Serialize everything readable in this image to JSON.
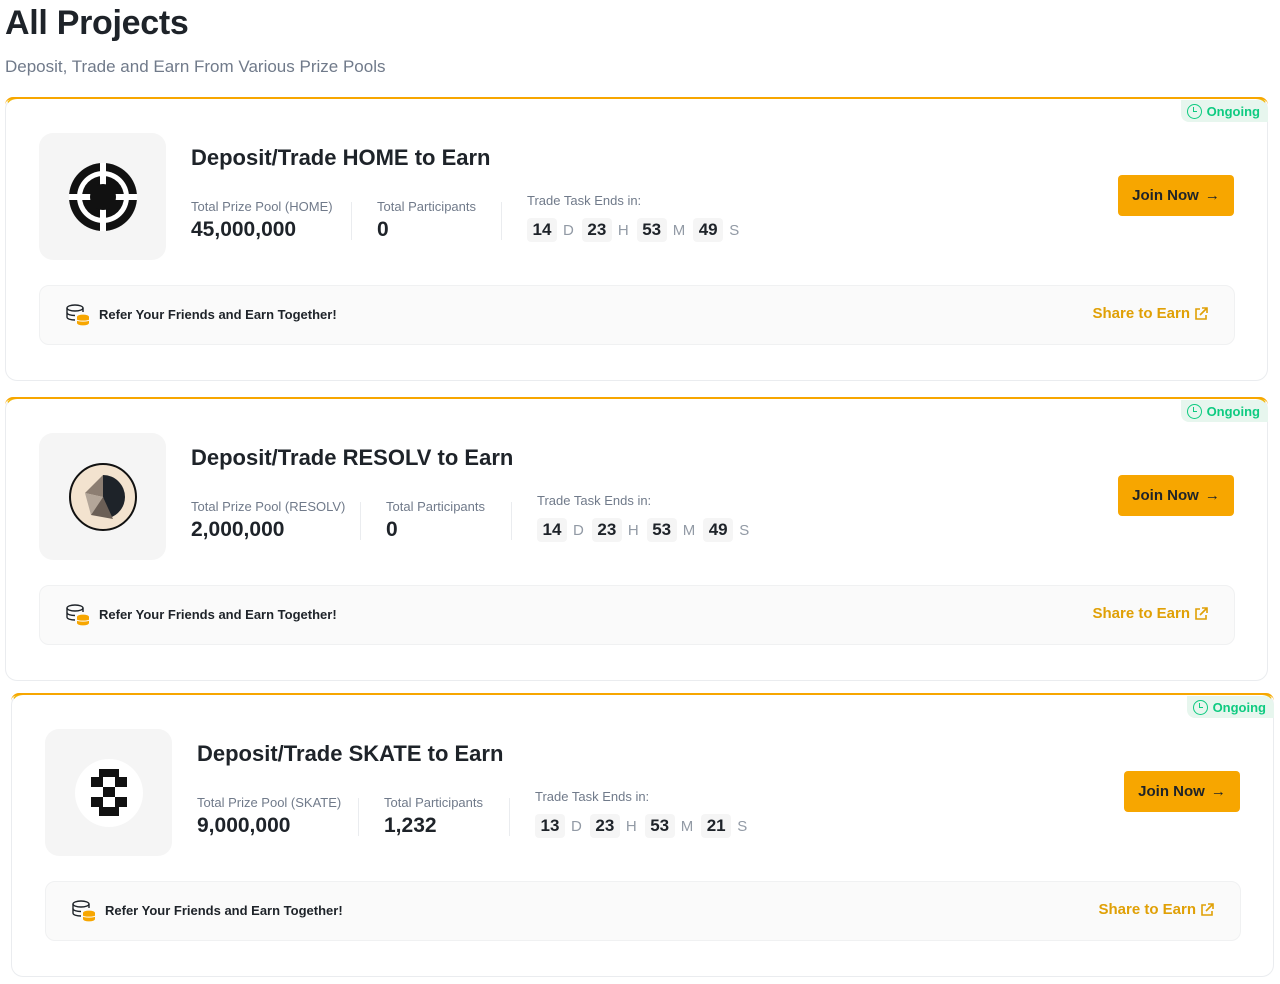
{
  "page": {
    "title": "All Projects",
    "subtitle": "Deposit, Trade and Earn From Various Prize Pools"
  },
  "colors": {
    "accent": "#f7a600",
    "status_green": "#0ecb81",
    "text": "#1e2329",
    "muted": "#707a8a"
  },
  "projects": [
    {
      "status": "Ongoing",
      "logo_icon": "home-logo-icon",
      "title": "Deposit/Trade HOME to Earn",
      "prize_pool_label": "Total Prize Pool (HOME)",
      "prize_pool_value": "45,000,000",
      "participants_label": "Total Participants",
      "participants_value": "0",
      "countdown_label": "Trade Task Ends in:",
      "countdown": {
        "days": "14",
        "hours": "23",
        "minutes": "53",
        "seconds": "49",
        "d": "D",
        "h": "H",
        "m": "M",
        "s": "S"
      },
      "join_label": "Join Now",
      "refer_text": "Refer Your Friends and Earn Together!",
      "share_label": "Share to Earn"
    },
    {
      "status": "Ongoing",
      "logo_icon": "resolv-logo-icon",
      "title": "Deposit/Trade RESOLV to Earn",
      "prize_pool_label": "Total Prize Pool (RESOLV)",
      "prize_pool_value": "2,000,000",
      "participants_label": "Total Participants",
      "participants_value": "0",
      "countdown_label": "Trade Task Ends in:",
      "countdown": {
        "days": "14",
        "hours": "23",
        "minutes": "53",
        "seconds": "49",
        "d": "D",
        "h": "H",
        "m": "M",
        "s": "S"
      },
      "join_label": "Join Now",
      "refer_text": "Refer Your Friends and Earn Together!",
      "share_label": "Share to Earn"
    },
    {
      "status": "Ongoing",
      "logo_icon": "skate-logo-icon",
      "title": "Deposit/Trade SKATE to Earn",
      "prize_pool_label": "Total Prize Pool (SKATE)",
      "prize_pool_value": "9,000,000",
      "participants_label": "Total Participants",
      "participants_value": "1,232",
      "countdown_label": "Trade Task Ends in:",
      "countdown": {
        "days": "13",
        "hours": "23",
        "minutes": "53",
        "seconds": "21",
        "d": "D",
        "h": "H",
        "m": "M",
        "s": "S"
      },
      "join_label": "Join Now",
      "refer_text": "Refer Your Friends and Earn Together!",
      "share_label": "Share to Earn"
    }
  ]
}
